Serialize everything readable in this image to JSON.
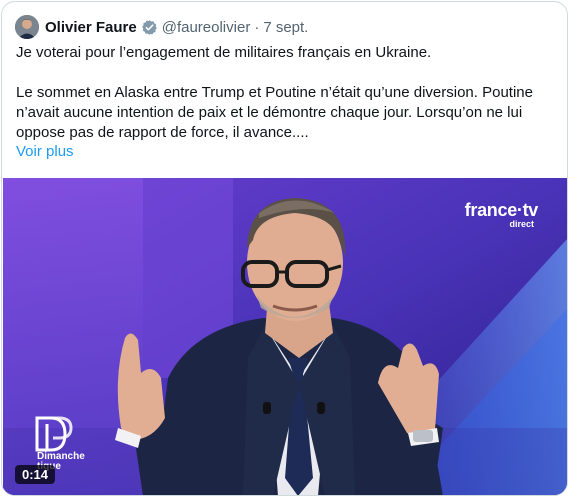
{
  "tweet": {
    "author_name": "Olivier Faure",
    "handle": "@faureolivier",
    "separator": "·",
    "date": "7 sept.",
    "paragraph1": "Je voterai pour l’engagement de militaires français en Ukraine.",
    "paragraph2": "Le sommet en Alaska entre Trump et Poutine n’était qu’une diversion. Poutine n’avait aucune intention de paix et le démontre chaque jour. Lorsqu’on ne lui oppose pas de rapport de force, il avance....",
    "show_more": "Voir plus"
  },
  "video": {
    "channel_brand": "france·tv",
    "channel_sub": "direct",
    "show_logo_line1": "Dimanche",
    "show_logo_line2": "tique",
    "timestamp": "0:14"
  },
  "icons": {
    "verified": "verified-badge-icon",
    "avatar": "avatar"
  },
  "colors": {
    "link": "#1d9bf0",
    "handle": "#536471",
    "background_purple": "#3a2ba0"
  }
}
